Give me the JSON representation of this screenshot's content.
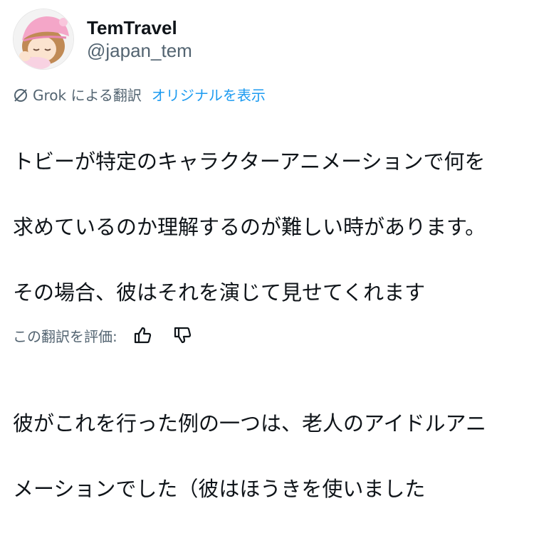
{
  "author": {
    "display_name": "TemTravel",
    "handle": "@japan_tem",
    "avatar_icon": "sleeping-pink-hat-character-avatar"
  },
  "translation": {
    "icon": "grok-icon",
    "label": "Grok による翻訳",
    "show_original": "オリジナルを表示"
  },
  "post": {
    "lines_p1": [
      "トビーが特定のキャラクターアニメーションで何を",
      "求めているのか理解するのが難しい時があります。",
      "その場合、彼はそれを演じて見せてくれます"
    ],
    "lines_p2": [
      "彼がこれを行った例の一つは、老人のアイドルアニ",
      "メーションでした（彼はほうきを使いました"
    ]
  },
  "rating": {
    "label": "この翻訳を評価:",
    "thumbs_up_icon": "thumbs-up-icon",
    "thumbs_down_icon": "thumbs-down-icon"
  },
  "colors": {
    "text": "#0f1419",
    "secondary": "#536471",
    "link": "#1d9bf0",
    "avatar_hat": "#f4a6c8",
    "avatar_hair": "#c08a55"
  }
}
